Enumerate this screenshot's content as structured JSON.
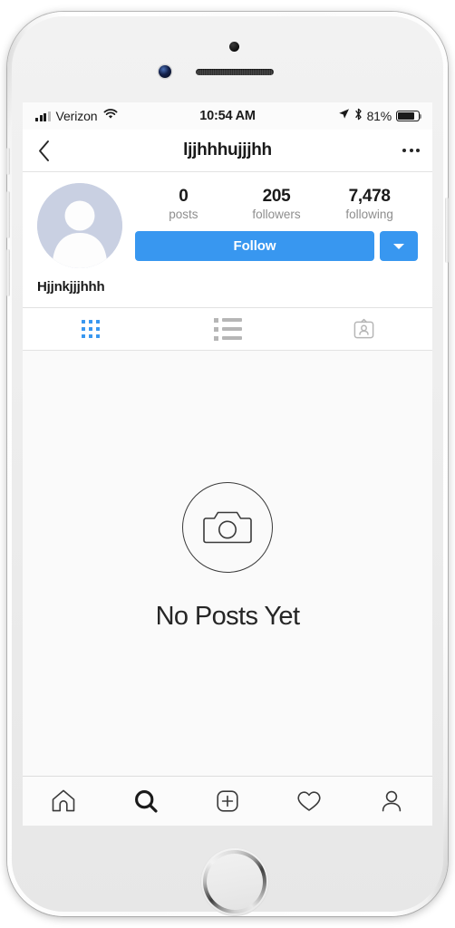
{
  "status_bar": {
    "carrier": "Verizon",
    "time": "10:54 AM",
    "battery_percent": "81%",
    "signal_bars_filled": 3,
    "signal_bars_total": 4,
    "wifi_icon": "wifi-icon",
    "location_icon": "location-arrow-icon",
    "bluetooth_icon": "bluetooth-icon",
    "battery_icon": "battery-icon"
  },
  "nav_header": {
    "back_icon": "back-chevron-icon",
    "title": "ljjhhhujjjhh",
    "more_icon": "more-options-icon"
  },
  "profile": {
    "avatar_icon": "default-avatar-icon",
    "display_name": "Hjjnkjjjhhh",
    "stats": [
      {
        "value": "0",
        "label": "posts"
      },
      {
        "value": "205",
        "label": "followers"
      },
      {
        "value": "7,478",
        "label": "following"
      }
    ],
    "follow_label": "Follow",
    "dropdown_icon": "chevron-down-icon"
  },
  "profile_tabs": [
    {
      "name": "grid-view-tab",
      "icon": "grid-icon",
      "active": true
    },
    {
      "name": "list-view-tab",
      "icon": "list-icon",
      "active": false
    },
    {
      "name": "tagged-posts-tab",
      "icon": "tagged-badge-icon",
      "active": false
    }
  ],
  "empty_state": {
    "icon": "camera-outline-icon",
    "text": "No Posts Yet"
  },
  "bottom_nav": [
    {
      "name": "home-tab",
      "icon": "home-icon",
      "active": false
    },
    {
      "name": "search-tab",
      "icon": "search-icon",
      "active": true
    },
    {
      "name": "new-post-tab",
      "icon": "plus-square-icon",
      "active": false
    },
    {
      "name": "activity-tab",
      "icon": "heart-icon",
      "active": false
    },
    {
      "name": "profile-tab",
      "icon": "person-icon",
      "active": false
    }
  ],
  "colors": {
    "accent_blue": "#3897f0",
    "text_primary": "#262626",
    "text_secondary": "#8e8e8e",
    "background": "#fafafa"
  }
}
